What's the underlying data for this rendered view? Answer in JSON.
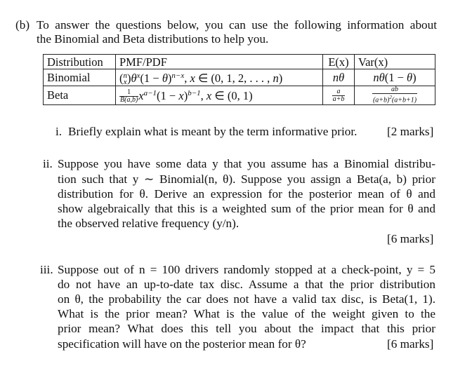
{
  "part_label": "(b)",
  "intro": {
    "line1": "To answer the questions below, you can use the following information about",
    "line2": "the Binomial and Beta distributions to help you."
  },
  "table": {
    "headers": [
      "Distribution",
      "PMF/PDF",
      "E(x)",
      "Var(x)"
    ],
    "rows": [
      {
        "distribution": "Binomial",
        "pmf": "(n choose x) θ^x (1 − θ)^(n−x), x ∈ (0, 1, 2, . . . , n)",
        "mean": "nθ",
        "variance": "nθ(1 − θ)"
      },
      {
        "distribution": "Beta",
        "pmf": "1/B(a,b) x^(a−1) (1 − x)^(b−1), x ∈ (0, 1)",
        "mean": "a/(a+b)",
        "variance": "ab/((a+b)^2 (a+b+1))"
      }
    ]
  },
  "questions": [
    {
      "label": "i.",
      "lines": [
        "Briefly explain what is meant by the term informative prior."
      ],
      "marks": "[2 marks]"
    },
    {
      "label": "ii.",
      "lines": [
        "Suppose you have some data y that you assume has a Binomial distribu-",
        "tion such that y ∼ Binomial(n, θ). Suppose you assign a Beta(a, b) prior",
        "distribution for θ. Derive an expression for the posterior mean of θ and",
        "show algebraically that this is a weighted sum of the prior mean for θ and",
        "the observed relative frequency (y/n)."
      ],
      "marks": "[6 marks]"
    },
    {
      "label": "iii.",
      "lines": [
        "Suppose out of n = 100 drivers randomly stopped at a check-point, y = 5",
        "do not have an up-to-date tax disc. Assume a that the prior distribution",
        "on θ, the probability the car does not have a valid tax disc, is Beta(1, 1).",
        "What is the prior mean? What is the value of the weight given to the",
        "prior mean? What does this tell you about the impact that this prior",
        "specification will have on the posterior mean for θ?"
      ],
      "marks": "[6 marks]"
    }
  ]
}
